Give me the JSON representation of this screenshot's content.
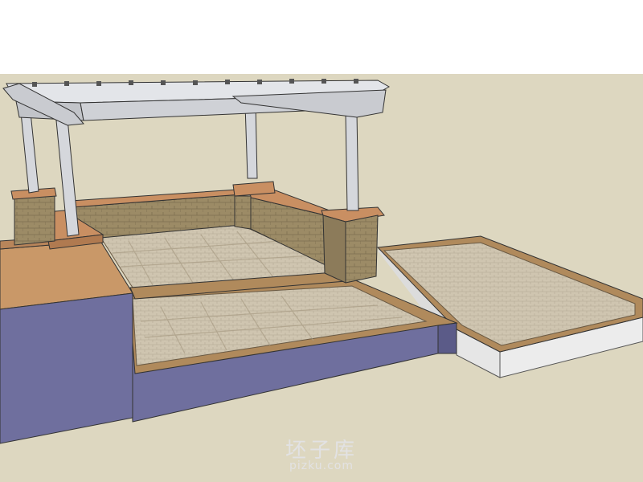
{
  "watermark": {
    "brand": "坯子库",
    "url": "pizku.com"
  },
  "colors": {
    "sky": "#ffffff",
    "ground": "#ddd7c0",
    "paver": "#cfc5b0",
    "paver_dark": "#a79c86",
    "wall_face": "#6f6f9e",
    "wall_side": "#8c8cb8",
    "coping": "#d3a072",
    "stone": "#9c8b66",
    "pergola": "#d5d7dc"
  }
}
